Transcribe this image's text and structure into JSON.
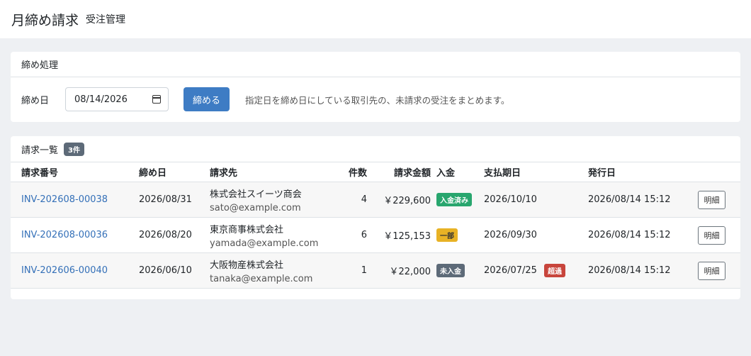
{
  "header": {
    "title": "月締め請求",
    "subtitle": "受注管理"
  },
  "closing": {
    "card_title": "締め処理",
    "date_label": "締め日",
    "date_value": "08/14/2026",
    "button_label": "締める",
    "help_text": "指定日を締め日にしている取引先の、未請求の受注をまとめます。"
  },
  "invoices": {
    "card_title": "請求一覧",
    "count_badge": "3件",
    "columns": [
      "請求番号",
      "締め日",
      "請求先",
      "件数",
      "請求金額",
      "入金",
      "支払期日",
      "発行日",
      ""
    ],
    "detail_label": "明細",
    "rows": [
      {
        "invoice_no": "INV-202608-00038",
        "closing_date": "2026/08/31",
        "customer_name": "株式会社スイーツ商会",
        "customer_email": "sato@example.com",
        "count": "4",
        "amount": "￥229,600",
        "payment_status": "入金済み",
        "payment_color": "#28a66e",
        "due_date": "2026/10/10",
        "overdue": "",
        "issued_at": "2026/08/14 15:12"
      },
      {
        "invoice_no": "INV-202608-00036",
        "closing_date": "2026/08/20",
        "customer_name": "東京商事株式会社",
        "customer_email": "yamada@example.com",
        "count": "6",
        "amount": "￥125,153",
        "payment_status": "一部",
        "payment_color": "#e8b225",
        "due_date": "2026/09/30",
        "overdue": "",
        "issued_at": "2026/08/14 15:12"
      },
      {
        "invoice_no": "INV-202606-00040",
        "closing_date": "2026/06/10",
        "customer_name": "大阪物産株式会社",
        "customer_email": "tanaka@example.com",
        "count": "1",
        "amount": "￥22,000",
        "payment_status": "未入金",
        "payment_color": "#5d6a78",
        "due_date": "2026/07/25",
        "overdue": "超過",
        "overdue_color": "#c8453c",
        "issued_at": "2026/08/14 15:12"
      }
    ]
  }
}
